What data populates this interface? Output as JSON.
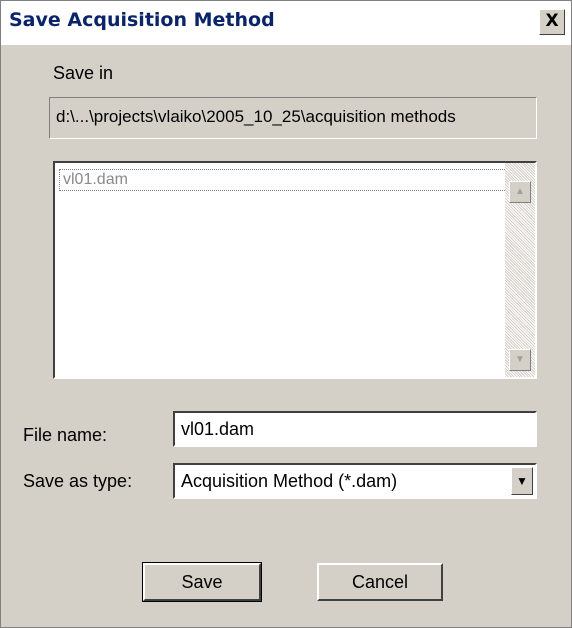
{
  "dialog": {
    "title": "Save Acquisition Method",
    "close_label": "X"
  },
  "save_in": {
    "label": "Save in",
    "path": "d:\\...\\projects\\vlaiko\\2005_10_25\\acquisition methods"
  },
  "file_list": {
    "items": [
      "vl01.dam"
    ]
  },
  "file_name": {
    "label": "File name:",
    "value": "vl01.dam"
  },
  "save_as_type": {
    "label": "Save as type:",
    "selected": "Acquisition Method (*.dam)"
  },
  "buttons": {
    "save": "Save",
    "cancel": "Cancel"
  },
  "icons": {
    "close": "close-icon",
    "scroll_up": "scroll-up-arrow-icon",
    "scroll_down": "scroll-down-arrow-icon",
    "dropdown": "chevron-down-icon"
  },
  "colors": {
    "dialog_bg": "#d4d0c8",
    "title_text": "#0a246a",
    "list_item_text": "#8a8a8a"
  }
}
